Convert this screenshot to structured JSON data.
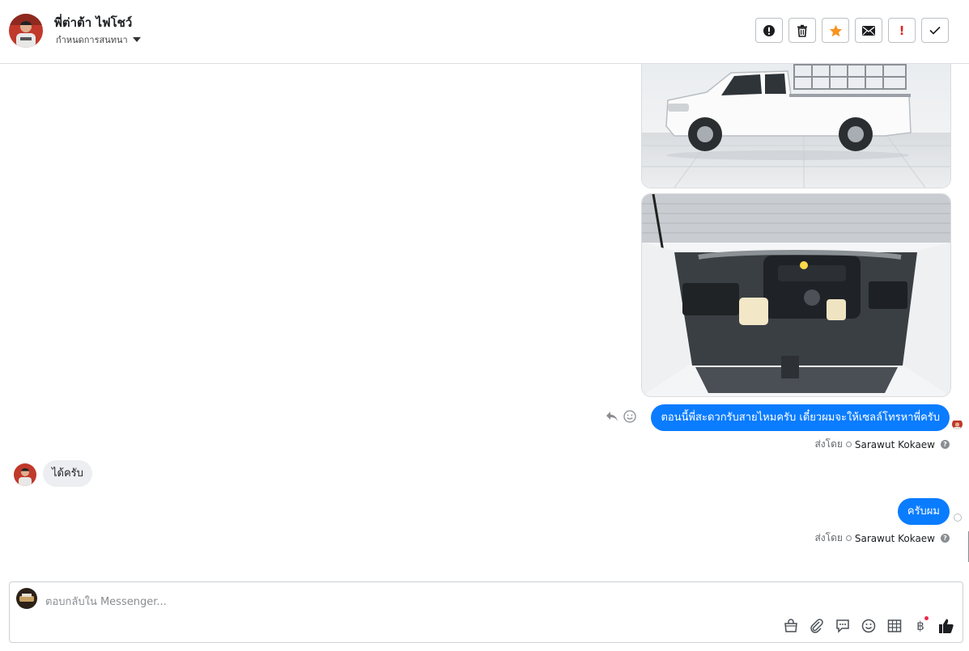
{
  "header": {
    "contact_name": "พี่ต่าต้า ไฟโชว์",
    "assign_label": "กำหนดการสนทนา",
    "actions": [
      {
        "name": "spam-button",
        "icon": "alert-circle-icon"
      },
      {
        "name": "delete-button",
        "icon": "trash-icon"
      },
      {
        "name": "star-button",
        "icon": "star-icon"
      },
      {
        "name": "mark-unread-button",
        "icon": "envelope-icon"
      },
      {
        "name": "follow-up-button",
        "icon": "exclamation-icon"
      },
      {
        "name": "mark-done-button",
        "icon": "check-icon"
      }
    ],
    "accent_colors": {
      "star": "#f7931e",
      "exclamation": "#e02424"
    }
  },
  "thread": {
    "images": [
      {
        "icon": "white-pickup-truck-photo"
      },
      {
        "icon": "engine-bay-photo"
      }
    ],
    "messages": [
      {
        "direction": "outgoing",
        "text": "ตอนนี้พี่สะดวกรับสายไหมครับ เดี๋ยวผมจะให้เซลล์โทรหาพี่ครับ"
      },
      {
        "direction": "incoming",
        "text": "ได้ครับ"
      },
      {
        "direction": "outgoing",
        "text": "ครับผม"
      }
    ],
    "sent_by_label": "ส่งโดย",
    "sent_by_name": "Sarawut Kokaew",
    "bubble_color": "#0a7cff"
  },
  "composer": {
    "placeholder": "ตอบกลับใน Messenger...",
    "value": "",
    "tools": [
      "store-icon",
      "paperclip-icon",
      "saved-reply-icon",
      "emoji-icon",
      "table-icon",
      "baht-icon",
      "thumbs-up-icon"
    ],
    "baht_symbol": "฿"
  }
}
